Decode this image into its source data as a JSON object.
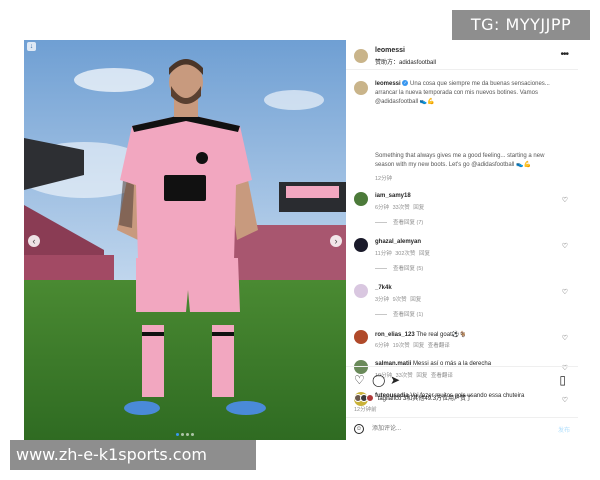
{
  "watermarks": {
    "top": "TG: MYYJJPP",
    "bottom": "www.zh-e-k1sports.com"
  },
  "post": {
    "author": "leomessi",
    "sponsor_line": "赞助方：adidasfootball",
    "caption_es": "Una cosa que siempre me da buenas sensaciones... arrancar la nueva temporada con mis nuevos botines. Vamos @adidasfootball 👟💪",
    "caption_en": "Something that always gives me a good feeling... starting a new season with my new boots. Let's go @adidasfootball 👟💪",
    "time": "12分钟"
  },
  "comments": [
    {
      "user": "iam_samy18",
      "text": "",
      "time": "6分钟",
      "likes": "33次赞",
      "reply": "回复",
      "extra": "",
      "view_replies": "查看回复 (7)",
      "avatar_color": "#4c7a3a"
    },
    {
      "user": "ghazal_alemyan",
      "text": "",
      "time": "11分钟",
      "likes": "302次赞",
      "reply": "回复",
      "extra": "",
      "view_replies": "查看回复 (5)",
      "avatar_color": "#1a1a2a"
    },
    {
      "user": "_7k4k",
      "text": "",
      "time": "3分钟",
      "likes": "9次赞",
      "reply": "回复",
      "extra": "",
      "view_replies": "查看回复 (1)",
      "avatar_color": "#d9c7e0"
    },
    {
      "user": "ron_elias_123",
      "text": "The real goat⚽🐐",
      "time": "6分钟",
      "likes": "19次赞",
      "reply": "回复",
      "extra": "查看翻译",
      "view_replies": "",
      "avatar_color": "#b04a2a"
    },
    {
      "user": "salman.matii",
      "text": "Messi así o más a la derecha",
      "time": "10分钟",
      "likes": "33次赞",
      "reply": "回复",
      "extra": "查看翻译",
      "view_replies": "",
      "avatar_color": "#6a8a5a"
    },
    {
      "user": "futeousadia",
      "text": "Vai fazer muitos gols usando essa chuteira",
      "time": "",
      "likes": "",
      "reply": "",
      "extra": "",
      "view_replies": "",
      "avatar_color": "#c9b23a"
    }
  ],
  "actions": {
    "likes_text": "tagliafico 3和其他49.3万位用户赞了",
    "time": "12分钟前",
    "comment_placeholder": "添加评论...",
    "post_label": "发布"
  },
  "colors": {
    "sky": "#7aa8d8",
    "pitch": "#3f7d2c",
    "kit_pink": "#f2a7c0",
    "accent_blue": "#3897f0"
  },
  "icons": [
    "more-icon",
    "verified-icon",
    "heart-icon",
    "comment-icon",
    "share-icon",
    "bookmark-icon",
    "emoji-icon",
    "chevron-left-icon",
    "chevron-right-icon"
  ]
}
